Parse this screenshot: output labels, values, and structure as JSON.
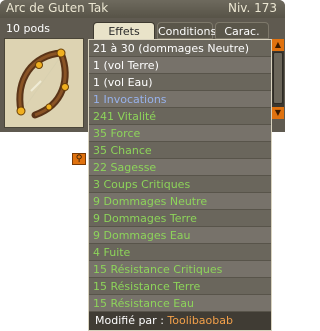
{
  "window": {
    "title": "Arc de Guten Tak",
    "level": "Niv. 173",
    "pods": "10 pods"
  },
  "tabs": [
    {
      "label": "Effets",
      "active": true
    },
    {
      "label": "Conditions",
      "active": false
    },
    {
      "label": "Carac.",
      "active": false
    }
  ],
  "effects": [
    {
      "text": "21 à 30 (dommages Neutre)",
      "color": "white"
    },
    {
      "text": "1 (vol Terre)",
      "color": "white"
    },
    {
      "text": "1 (vol Eau)",
      "color": "white"
    },
    {
      "text": "1 Invocations",
      "color": "blue"
    },
    {
      "text": "241 Vitalité",
      "color": "green"
    },
    {
      "text": "35 Force",
      "color": "green"
    },
    {
      "text": "35 Chance",
      "color": "green"
    },
    {
      "text": "22 Sagesse",
      "color": "green"
    },
    {
      "text": "3 Coups Critiques",
      "color": "green"
    },
    {
      "text": "9 Dommages Neutre",
      "color": "green"
    },
    {
      "text": "9 Dommages Terre",
      "color": "green"
    },
    {
      "text": "9 Dommages Eau",
      "color": "green"
    },
    {
      "text": "4 Fuite",
      "color": "green"
    },
    {
      "text": "15 Résistance Critiques",
      "color": "green"
    },
    {
      "text": "15 Résistance Terre",
      "color": "green"
    },
    {
      "text": "15 Résistance Eau",
      "color": "green"
    }
  ],
  "footer": {
    "prefix": "Modifié par : ",
    "author": "Toolibaobab"
  },
  "icons": {
    "zoom": "magnifier-icon",
    "scroll_up": "arrow-up-icon",
    "scroll_down": "arrow-down-icon"
  },
  "colors": {
    "effect_white": "#ffffff",
    "effect_blue": "#97b1ea",
    "effect_green": "#8dd45a",
    "author": "#f2a04a",
    "accent": "#e0720f"
  }
}
